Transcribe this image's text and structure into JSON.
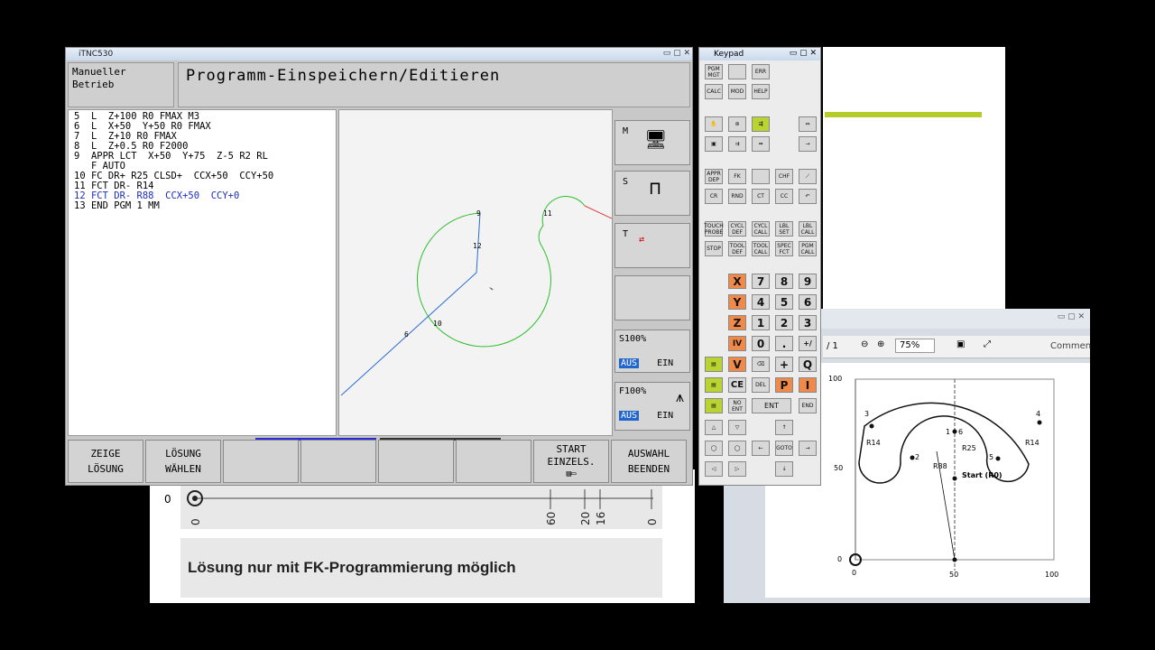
{
  "tnc": {
    "window_title": "iTNC530",
    "mode": "Manueller\nBetrieb",
    "title": "Programm-Einspeichern/Editieren",
    "program_lines": [
      {
        "text": "5  L  Z+100 R0 FMAX M3",
        "active": false
      },
      {
        "text": "6  L  X+50  Y+50 R0 FMAX",
        "active": false
      },
      {
        "text": "7  L  Z+10 R0 FMAX",
        "active": false
      },
      {
        "text": "8  L  Z+0.5 R0 F2000",
        "active": false
      },
      {
        "text": "9  APPR LCT  X+50  Y+75  Z-5 R2 RL",
        "active": false
      },
      {
        "text": "   F AUTO",
        "active": false
      },
      {
        "text": "10 FC DR+ R25 CLSD+  CCX+50  CCY+50",
        "active": false
      },
      {
        "text": "11 FCT DR- R14",
        "active": false
      },
      {
        "text": "12 FCT DR- R88  CCX+50  CCY+0",
        "active": true
      },
      {
        "text": "13 END PGM 1 MM",
        "active": false
      }
    ],
    "graphic_labels": {
      "n9": "9",
      "n12": "12",
      "n11": "11",
      "n10": "10",
      "n6": "6"
    },
    "side_keys": {
      "m": "M",
      "s": "S",
      "t": "T",
      "spindle": "S100%",
      "spindle_off": "AUS",
      "spindle_on": "EIN",
      "feed": "F100%",
      "feed_off": "AUS",
      "feed_on": "EIN"
    },
    "softkeys": [
      [
        "ZEIGE",
        "LÖSUNG"
      ],
      [
        "LÖSUNG",
        "WÄHLEN"
      ],
      [],
      [],
      [],
      [],
      [
        "START",
        "EINZELS."
      ],
      [
        "AUSWAHL",
        "BEENDEN"
      ]
    ]
  },
  "keypad": {
    "title": "Keypad",
    "keys": [
      "PGM MGT",
      "",
      "ERR",
      "CALC",
      "MOD",
      "HELP",
      "APPR DEP",
      "FK",
      "",
      "CHF",
      "CR",
      "RND",
      "CT",
      "CC",
      "TOUCH PROBE",
      "CYCL DEF",
      "CYCL CALL",
      "LBL SET",
      "LBL CALL",
      "STOP",
      "TOOL DEF",
      "TOOL CALL",
      "SPEC FCT",
      "PGM CALL",
      "X",
      "7",
      "8",
      "9",
      "Y",
      "4",
      "5",
      "6",
      "Z",
      "1",
      "2",
      "3",
      "IV",
      "0",
      ".",
      "+/",
      "V",
      "",
      "+",
      "Q",
      "CE",
      "DEL",
      "P",
      "I",
      "NO ENT",
      "ENT",
      "END",
      "GOTO"
    ]
  },
  "doc_left": {
    "ticks": [
      "0",
      "60",
      "20",
      "16",
      "0"
    ],
    "origin": "0",
    "note": "Lösung nur mit FK-Programmierung möglich"
  },
  "pdf": {
    "page_info": "/ 1",
    "zoom": "75%",
    "comment": "Commen",
    "labels": {
      "y100": "100",
      "y50": "50",
      "y0": "0",
      "x0": "0",
      "x50": "50",
      "x100": "100",
      "r14a": "R14",
      "r14b": "R14",
      "r25": "R25",
      "r88": "R88",
      "p1": "1",
      "p2": "2",
      "p3": "3",
      "p4": "4",
      "p5": "5",
      "p6": "6",
      "start": "Start (R0)"
    }
  },
  "colors": {
    "contour": "#2bbf2b",
    "path": "#2a6bd8",
    "highlight": "#b5cc2a",
    "keypad_orange": "#f08a4b",
    "keypad_green": "#b9d432"
  }
}
